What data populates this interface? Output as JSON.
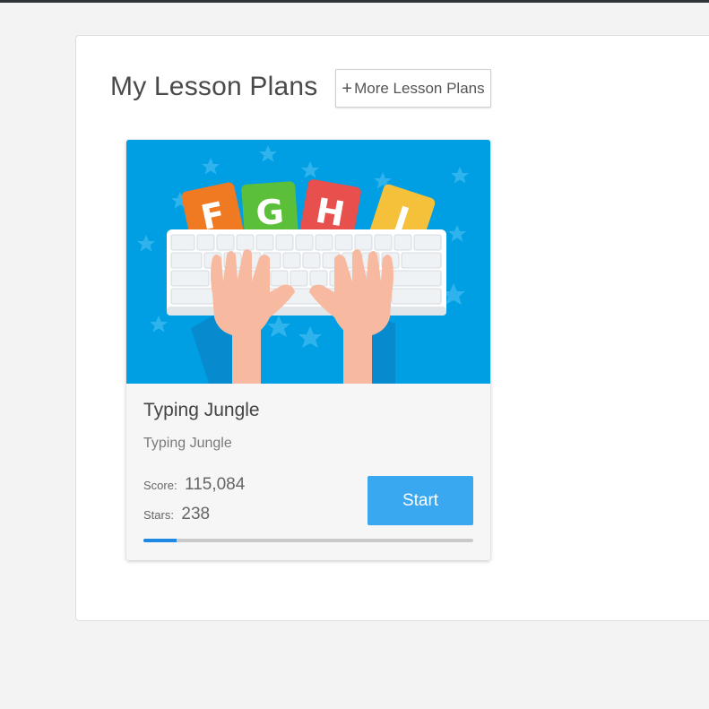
{
  "panel": {
    "title": "My Lesson Plans",
    "more_button": {
      "icon": "plus-icon",
      "label": "More Lesson Plans"
    }
  },
  "lesson_card": {
    "title": "Typing Jungle",
    "subtitle": "Typing Jungle",
    "score_label": "Score:",
    "score_value": "115,084",
    "stars_label": "Stars:",
    "stars_value": "238",
    "start_label": "Start",
    "progress_fraction": 0.1,
    "image": {
      "icon": "typing-hands-keyboard-illustration",
      "letter_blocks": [
        "F",
        "G",
        "H",
        "J"
      ]
    }
  },
  "colors": {
    "accent": "#3aa8f0",
    "progress": "#1e88e5",
    "image_background": "#009fe3"
  }
}
